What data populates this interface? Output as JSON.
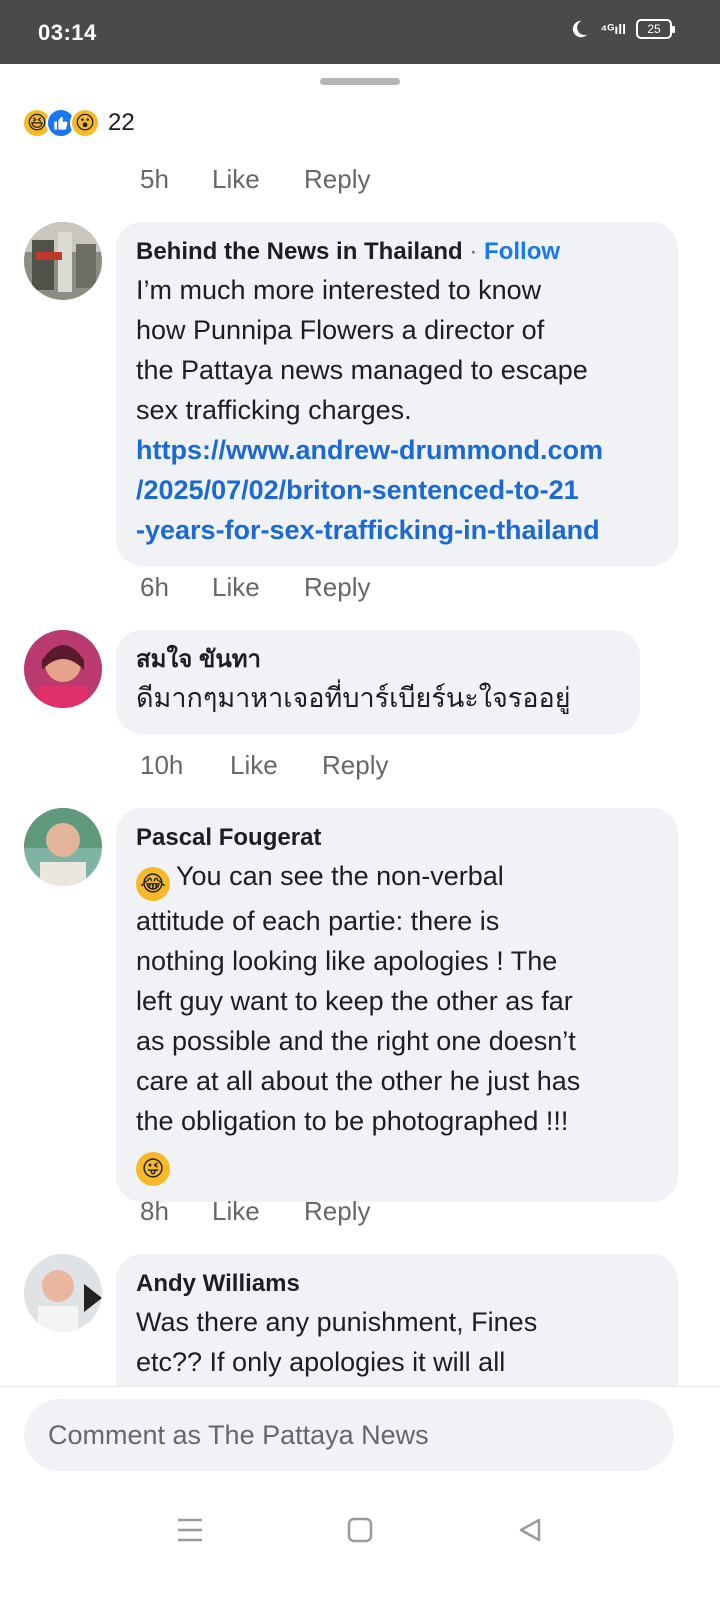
{
  "status_bar": {
    "time": "03:14",
    "signal": "⁴ᴳıll",
    "battery": "25"
  },
  "colors": {
    "link": "#1a69d4",
    "follow": "#1877f2",
    "bubble": "#f0f2f5",
    "meta": "#65676b"
  },
  "top": {
    "reactions": [
      "laugh-icon",
      "like-icon",
      "wow-icon"
    ],
    "reaction_count": "22",
    "time": "5h",
    "like": "Like",
    "reply": "Reply"
  },
  "comments": [
    {
      "author": "Behind the News in Thailand",
      "separator": "·",
      "follow": "Follow",
      "lines": [
        "I’m much more interested to know",
        "how Punnipa Flowers a director of",
        "the Pattaya news managed to escape",
        "sex trafficking charges."
      ],
      "link_lines": [
        "https://www.andrew-drummond.com",
        "/2025/07/02/briton-sentenced-to-21",
        "-years-for-sex-trafficking-in-thailand"
      ],
      "time": "6h",
      "like": "Like",
      "reply": "Reply"
    },
    {
      "author": "สมใจ ขันทา",
      "lines": [
        "ดีมากๆมาหาเจอที่บาร์เบียร์นะใจรออยู่"
      ],
      "time": "10h",
      "like": "Like",
      "reply": "Reply"
    },
    {
      "author": "Pascal Fougerat",
      "lines": [
        "You can see the non-verbal",
        "attitude of each partie: there is",
        "nothing looking like apologies ! The",
        "left guy want to keep the other as far",
        "as possible and the right one doesn’t",
        "care at all about the other he just has",
        "the obligation to be photographed !!!"
      ],
      "time": "8h",
      "like": "Like",
      "reply": "Reply"
    },
    {
      "author": "Andy Williams",
      "lines": [
        "Was there any punishment, Fines",
        "etc?? If only apologies it will all"
      ]
    }
  ],
  "composer": {
    "placeholder": "Comment as The Pattaya News"
  },
  "nav": [
    "menu-icon",
    "home-icon",
    "back-icon"
  ]
}
